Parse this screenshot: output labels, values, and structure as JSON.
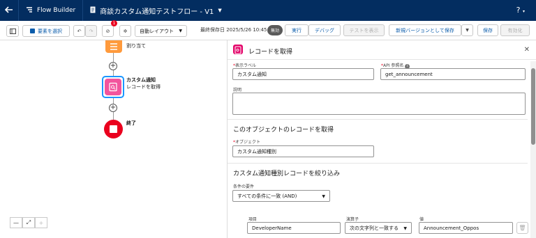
{
  "topbar": {
    "back_icon": "arrow-left-icon",
    "app_name": "Flow Builder",
    "flow_name": "商談カスタム通知テストフロー - V1",
    "help": "?"
  },
  "toolbar": {
    "select_elements": "要素を選択",
    "error_count": "1",
    "layout": "自動レイアウト",
    "last_saved": "最終保存日 2025/5/26 10:45",
    "status": "無効",
    "run": "実行",
    "debug": "デバッグ",
    "view_test": "テストを表示",
    "save_as_new": "新規バージョンとして保存",
    "save": "保存",
    "activate": "有効化"
  },
  "canvas": {
    "assign_label": "割り当て",
    "get_records_node_title": "カスタム通知",
    "get_records_node_sub": "レコードを取得",
    "end_label": "終了"
  },
  "panel": {
    "title": "レコードを取得",
    "label_field_label": "表示ラベル",
    "label_field_value": "カスタム通知",
    "api_field_label": "API 参照名",
    "api_field_value": "get_announcement",
    "description_label": "説明",
    "section_object": "このオブジェクトのレコードを取得",
    "object_label": "オブジェクト",
    "object_value": "カスタム通知種別",
    "section_filter": "カスタム通知種別レコードを絞り込み",
    "condition_label": "条件の要件",
    "condition_value": "すべての条件に一致 (AND)",
    "col_field": "項目",
    "col_operator": "演算子",
    "col_value": "値",
    "row_field": "DeveloperName",
    "row_operator": "次の文字列と一致する",
    "row_value": "Announcement_Oppos"
  },
  "colors": {
    "header_bg": "#032d60",
    "assignment_node": "#ff9a3c",
    "get_records_node": "#f2549d",
    "end_node": "#ea001e"
  }
}
